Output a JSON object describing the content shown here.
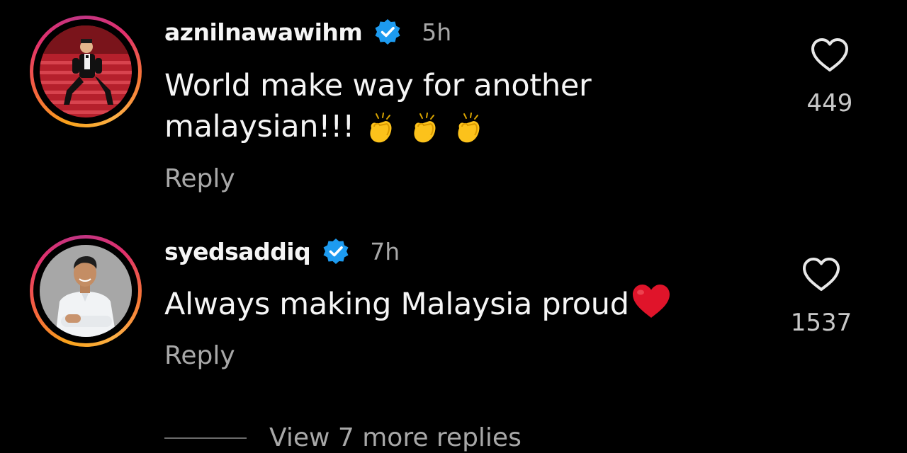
{
  "comments": [
    {
      "username": "aznilnawawihm",
      "verified": true,
      "time": "5h",
      "text_line1": "World make way for another",
      "text_line2": "malaysian!!!",
      "emojis": [
        "clapping-hands",
        "clapping-hands",
        "clapping-hands"
      ],
      "reply_label": "Reply",
      "like_count": "449"
    },
    {
      "username": "syedsaddiq",
      "verified": true,
      "time": "7h",
      "text": "Always making Malaysia proud",
      "emojis": [
        "red-heart"
      ],
      "reply_label": "Reply",
      "like_count": "1537"
    }
  ],
  "view_more_replies": "View 7 more replies",
  "colors": {
    "background": "#000000",
    "text_primary": "#f5f5f5",
    "text_secondary": "#a8a8a8",
    "verified_blue": "#1d9bf0",
    "heart_red": "#e0142a"
  }
}
